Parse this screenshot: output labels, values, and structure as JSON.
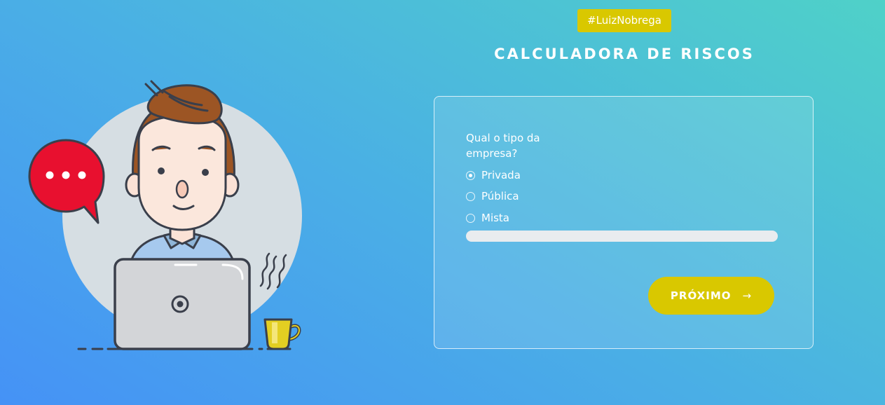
{
  "header": {
    "hashtag": "#LuizNobrega",
    "title": "CALCULADORA DE RISCOS"
  },
  "form": {
    "question": "Qual o tipo da empresa?",
    "options": [
      {
        "label": "Privada",
        "checked": true
      },
      {
        "label": "Pública",
        "checked": false
      },
      {
        "label": "Mista",
        "checked": false
      }
    ],
    "progress": 0,
    "next_label": "PRÓXIMO",
    "next_icon": "arrow-right-icon"
  },
  "colors": {
    "accent": "#d9c800",
    "background_start": "#4592f6",
    "background_end": "#4fd1c8",
    "speech_bubble": "#e8102f"
  }
}
